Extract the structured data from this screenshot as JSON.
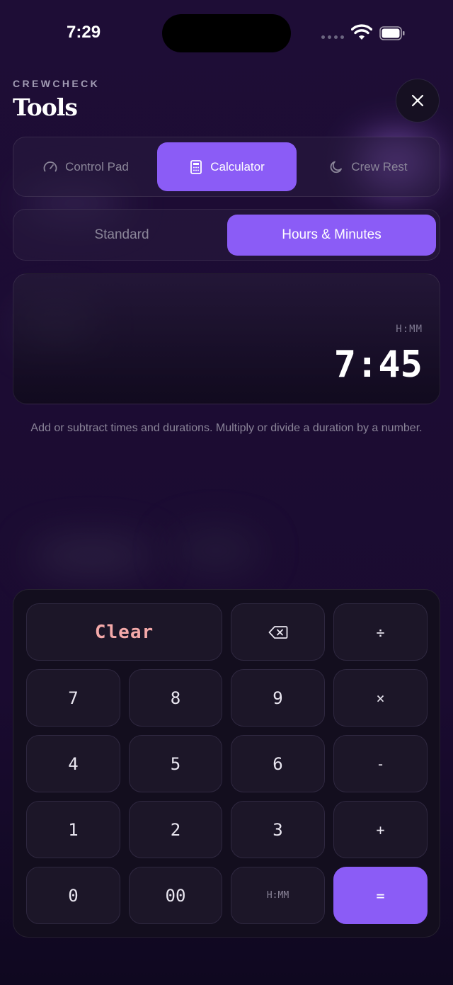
{
  "status_bar": {
    "time": "7:29"
  },
  "header": {
    "brand": "CREWCHECK",
    "title": "Tools"
  },
  "tools_tabs": [
    {
      "label": "Control Pad",
      "icon": "gauge-icon",
      "active": false
    },
    {
      "label": "Calculator",
      "icon": "calculator-icon",
      "active": true
    },
    {
      "label": "Crew Rest",
      "icon": "moon-icon",
      "active": false
    }
  ],
  "mode_tabs": [
    {
      "label": "Standard",
      "active": false
    },
    {
      "label": "Hours & Minutes",
      "active": true
    }
  ],
  "display": {
    "format_label": "H:MM",
    "value": "7:45"
  },
  "help_text": "Add or subtract times and durations. Multiply or divide a duration by a number.",
  "keypad": {
    "clear": "Clear",
    "backspace_icon": "backspace-icon",
    "divide": "÷",
    "k7": "7",
    "k8": "8",
    "k9": "9",
    "multiply": "×",
    "k4": "4",
    "k5": "5",
    "k6": "6",
    "minus": "-",
    "k1": "1",
    "k2": "2",
    "k3": "3",
    "plus": "+",
    "k0": "0",
    "k00": "00",
    "hmm": "H:MM",
    "equals": "="
  },
  "colors": {
    "accent": "#8b5cf6",
    "clear_text": "#f4a9a9",
    "background": "#1c0c33"
  }
}
